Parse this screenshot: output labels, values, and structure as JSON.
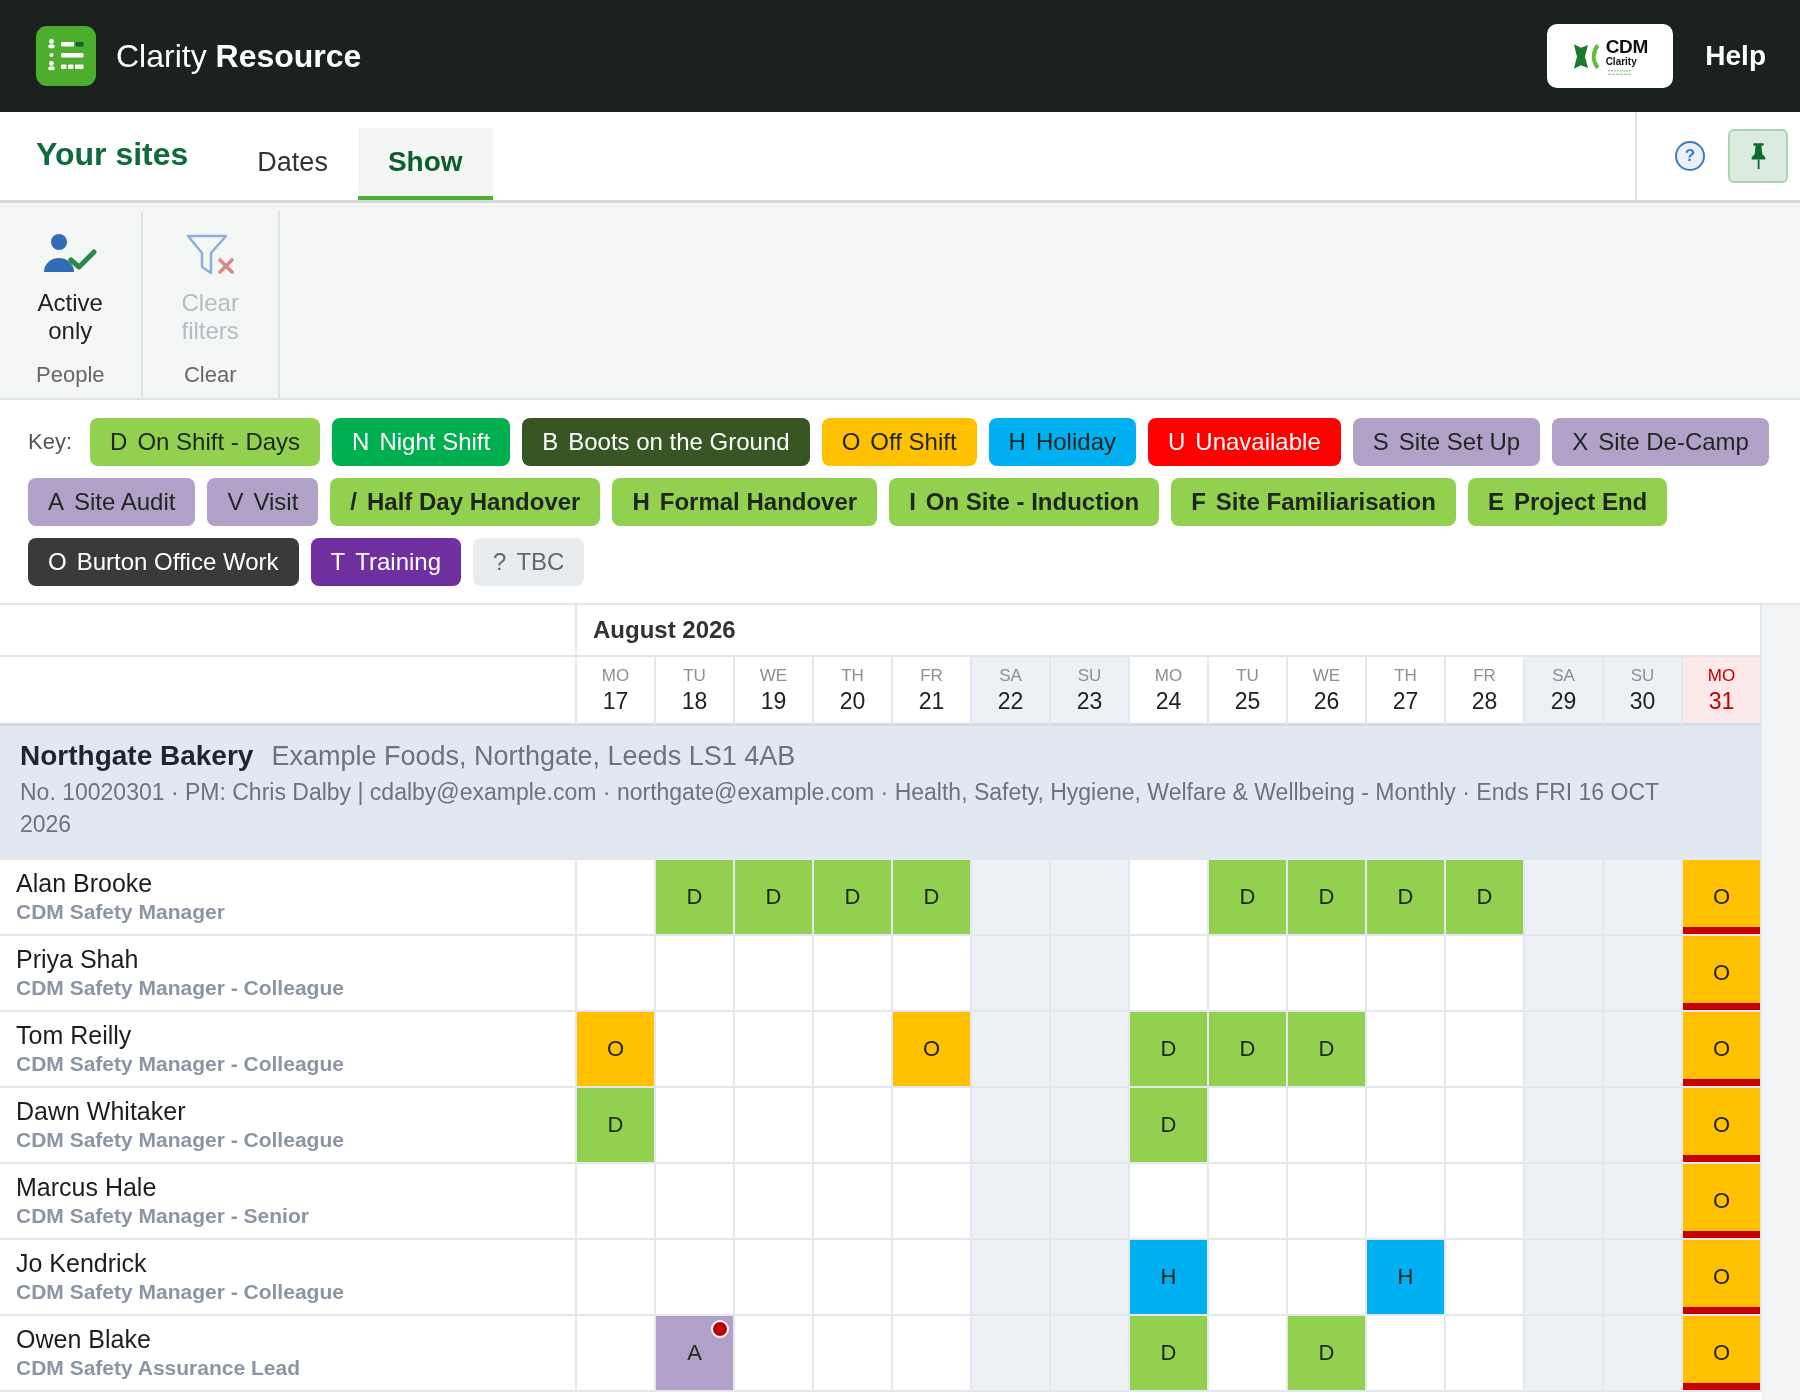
{
  "top_bar": {
    "title": "Clarity **Resource**",
    "partner_logo": {
      "line_1": "CDM",
      "line_2": "Clarity"
    },
    "help": "Help"
  },
  "page_title": "Your sites",
  "tabs": [
    {
      "label": "Dates",
      "selected": false
    },
    {
      "label": "Show",
      "selected": true
    }
  ],
  "help_button": {
    "label": "?"
  },
  "pin_button": {
    "on": true
  },
  "ribbon": {
    "groups": [
      {
        "label": "People",
        "buttons": [
          {
            "label": "Active only",
            "kind": "person-check",
            "disabled": false
          }
        ]
      },
      {
        "label": "Clear",
        "buttons": [
          {
            "label": "Clear filters",
            "kind": "clear-filter",
            "disabled": true
          }
        ]
      }
    ]
  },
  "key": {
    "label": "Key:",
    "items": [
      {
        "code": "D",
        "label": "On Shift - Days",
        "color": "#92d050",
        "bold": false
      },
      {
        "code": "N",
        "label": "Night Shift",
        "color": "#00b050",
        "bold": false
      },
      {
        "code": "B",
        "label": "Boots on the Ground",
        "color": "#375623",
        "bold": false
      },
      {
        "code": "O",
        "label": "Off Shift",
        "color": "#ffc000",
        "bold": false
      },
      {
        "code": "H",
        "label": "Holiday",
        "color": "#00b0f0",
        "bold": false
      },
      {
        "code": "U",
        "label": "Unavailable",
        "color": "#ff0000",
        "bold": false
      },
      {
        "code": "S",
        "label": "Site Set Up",
        "color": "#b1a0c7",
        "bold": false
      },
      {
        "code": "X",
        "label": "Site De-Camp",
        "color": "#b1a0c7",
        "bold": false
      },
      {
        "code": "A",
        "label": "Site Audit",
        "color": "#b1a0c7",
        "bold": false
      },
      {
        "code": "V",
        "label": "Visit",
        "color": "#b1a0c7",
        "bold": false
      },
      {
        "code": "/",
        "label": "Half Day Handover",
        "color": "#92d050",
        "bold": true
      },
      {
        "code": "H",
        "label": "Formal Handover",
        "color": "#92d050",
        "bold": true
      },
      {
        "code": "I",
        "label": "On Site - Induction",
        "color": "#92d050",
        "bold": true
      },
      {
        "code": "F",
        "label": "Site Familiarisation",
        "color": "#92d050",
        "bold": true
      },
      {
        "code": "E",
        "label": "Project End",
        "color": "#92d050",
        "bold": true
      },
      {
        "code": "O",
        "label": "Burton Office Work",
        "color": "#3a3a3a",
        "bold": false
      },
      {
        "code": "T",
        "label": "Training",
        "color": "#7030a0",
        "bold": false
      },
      {
        "code": "?",
        "label": "TBC",
        "color": "#e9ecef",
        "bold": false
      }
    ]
  },
  "calendar": {
    "month": "August 2026",
    "days": [
      {
        "dow": "MO",
        "day": "17",
        "weekend": false,
        "bank_holiday": false
      },
      {
        "dow": "TU",
        "day": "18",
        "weekend": false,
        "bank_holiday": false
      },
      {
        "dow": "WE",
        "day": "19",
        "weekend": false,
        "bank_holiday": false
      },
      {
        "dow": "TH",
        "day": "20",
        "weekend": false,
        "bank_holiday": false
      },
      {
        "dow": "FR",
        "day": "21",
        "weekend": false,
        "bank_holiday": false
      },
      {
        "dow": "SA",
        "day": "22",
        "weekend": true,
        "bank_holiday": false
      },
      {
        "dow": "SU",
        "day": "23",
        "weekend": true,
        "bank_holiday": false
      },
      {
        "dow": "MO",
        "day": "24",
        "weekend": false,
        "bank_holiday": false
      },
      {
        "dow": "TU",
        "day": "25",
        "weekend": false,
        "bank_holiday": false
      },
      {
        "dow": "WE",
        "day": "26",
        "weekend": false,
        "bank_holiday": false
      },
      {
        "dow": "TH",
        "day": "27",
        "weekend": false,
        "bank_holiday": false
      },
      {
        "dow": "FR",
        "day": "28",
        "weekend": false,
        "bank_holiday": false
      },
      {
        "dow": "SA",
        "day": "29",
        "weekend": true,
        "bank_holiday": false
      },
      {
        "dow": "SU",
        "day": "30",
        "weekend": true,
        "bank_holiday": false
      },
      {
        "dow": "MO",
        "day": "31",
        "weekend": false,
        "bank_holiday": true
      }
    ],
    "site": {
      "name": "Northgate Bakery",
      "address": "Example Foods, Northgate, Leeds LS1 4AB",
      "details": "No. 10020301 · PM: Chris Dalby | cdalby@example.com · northgate@example.com · Health, Safety, Hygiene, Welfare & Wellbeing - Monthly · Ends FRI 16 OCT 2026"
    },
    "people": [
      {
        "name": "Alan Brooke",
        "role": "CDM Safety Manager",
        "cells": [
          null,
          {
            "code": "D",
            "color": "#92d050",
            "has_note": false
          },
          {
            "code": "D",
            "color": "#92d050",
            "has_note": false
          },
          {
            "code": "D",
            "color": "#92d050",
            "has_note": false
          },
          {
            "code": "D",
            "color": "#92d050",
            "has_note": false
          },
          null,
          null,
          null,
          {
            "code": "D",
            "color": "#92d050",
            "has_note": false
          },
          {
            "code": "D",
            "color": "#92d050",
            "has_note": false
          },
          {
            "code": "D",
            "color": "#92d050",
            "has_note": false
          },
          {
            "code": "D",
            "color": "#92d050",
            "has_note": false
          },
          null,
          null,
          {
            "code": "O",
            "color": "#ffc000",
            "has_note": false
          }
        ]
      },
      {
        "name": "Priya Shah",
        "role": "CDM Safety Manager - Colleague",
        "cells": [
          null,
          null,
          null,
          null,
          null,
          null,
          null,
          null,
          null,
          null,
          null,
          null,
          null,
          null,
          {
            "code": "O",
            "color": "#ffc000",
            "has_note": false
          }
        ]
      },
      {
        "name": "Tom Reilly",
        "role": "CDM Safety Manager - Colleague",
        "cells": [
          {
            "code": "O",
            "color": "#ffc000",
            "has_note": false
          },
          null,
          null,
          null,
          {
            "code": "O",
            "color": "#ffc000",
            "has_note": false
          },
          null,
          null,
          {
            "code": "D",
            "color": "#92d050",
            "has_note": false
          },
          {
            "code": "D",
            "color": "#92d050",
            "has_note": false
          },
          {
            "code": "D",
            "color": "#92d050",
            "has_note": false
          },
          null,
          null,
          null,
          null,
          {
            "code": "O",
            "color": "#ffc000",
            "has_note": false
          }
        ]
      },
      {
        "name": "Dawn Whitaker",
        "role": "CDM Safety Manager - Colleague",
        "cells": [
          {
            "code": "D",
            "color": "#92d050",
            "has_note": false
          },
          null,
          null,
          null,
          null,
          null,
          null,
          {
            "code": "D",
            "color": "#92d050",
            "has_note": false
          },
          null,
          null,
          null,
          null,
          null,
          null,
          {
            "code": "O",
            "color": "#ffc000",
            "has_note": false
          }
        ]
      },
      {
        "name": "Marcus Hale",
        "role": "CDM Safety Manager - Senior",
        "cells": [
          null,
          null,
          null,
          null,
          null,
          null,
          null,
          null,
          null,
          null,
          null,
          null,
          null,
          null,
          {
            "code": "O",
            "color": "#ffc000",
            "has_note": false
          }
        ]
      },
      {
        "name": "Jo Kendrick",
        "role": "CDM Safety Manager - Colleague",
        "cells": [
          null,
          null,
          null,
          null,
          null,
          null,
          null,
          {
            "code": "H",
            "color": "#00b0f0",
            "has_note": false
          },
          null,
          null,
          {
            "code": "H",
            "color": "#00b0f0",
            "has_note": false
          },
          null,
          null,
          null,
          {
            "code": "O",
            "color": "#ffc000",
            "has_note": false
          }
        ]
      },
      {
        "name": "Owen Blake",
        "role": "CDM Safety Assurance Lead",
        "cells": [
          null,
          {
            "code": "A",
            "color": "#b1a0c7",
            "has_note": true
          },
          null,
          null,
          null,
          null,
          null,
          {
            "code": "D",
            "color": "#92d050",
            "has_note": false
          },
          null,
          {
            "code": "D",
            "color": "#92d050",
            "has_note": false
          },
          null,
          null,
          null,
          null,
          {
            "code": "O",
            "color": "#ffc000",
            "has_note": false
          }
        ]
      }
    ]
  }
}
